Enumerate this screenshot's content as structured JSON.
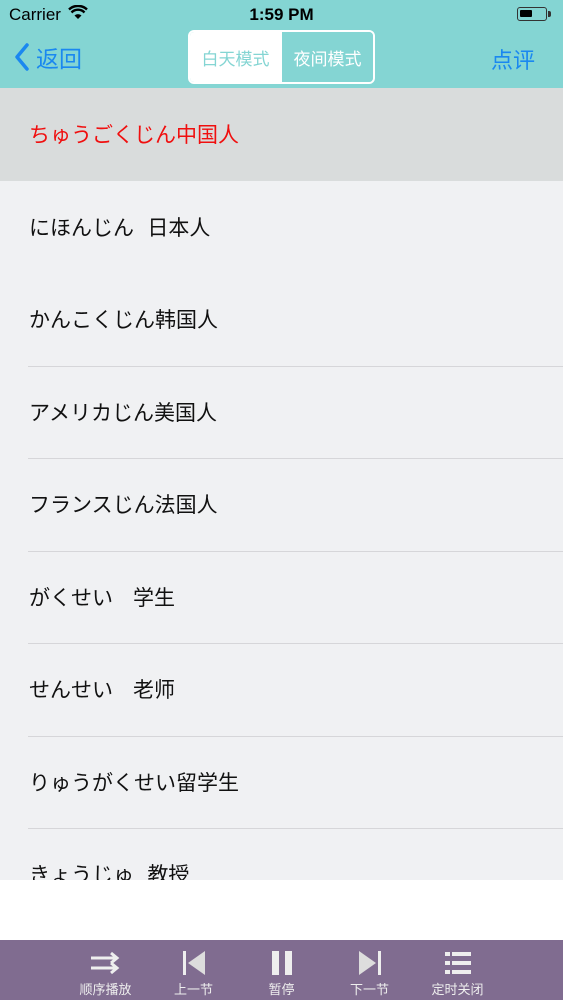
{
  "status": {
    "carrier": "Carrier",
    "time": "1:59 PM",
    "battery_level": 0.55
  },
  "nav": {
    "back_label": "返回",
    "mode_day": "白天模式",
    "mode_night": "夜间模式",
    "selected_mode": "night",
    "review_label": "点评"
  },
  "list": [
    {
      "kana": "ちゅうごくじん",
      "kanji": "中国人",
      "selected": true
    },
    {
      "kana": "にほんじん  ",
      "kanji": "日本人"
    },
    {
      "kana": "かんこくじん",
      "kanji": "韩国人"
    },
    {
      "kana": "アメリカじん",
      "kanji": "美国人"
    },
    {
      "kana": "フランスじん",
      "kanji": "法国人"
    },
    {
      "kana": "がくせい   ",
      "kanji": "学生"
    },
    {
      "kana": "せんせい   ",
      "kanji": "老师"
    },
    {
      "kana": "りゅうがくせい",
      "kanji": "留学生"
    },
    {
      "kana": "きょうじゅ  ",
      "kanji": "教授"
    }
  ],
  "player": {
    "order": "顺序播放",
    "prev": "上一节",
    "pause": "暂停",
    "next": "下一节",
    "timer": "定时关闭"
  },
  "colors": {
    "header": "#84d5d3",
    "accent": "#1a88f0",
    "selected_text": "#f00f0f",
    "player_bar": "#806c90"
  }
}
